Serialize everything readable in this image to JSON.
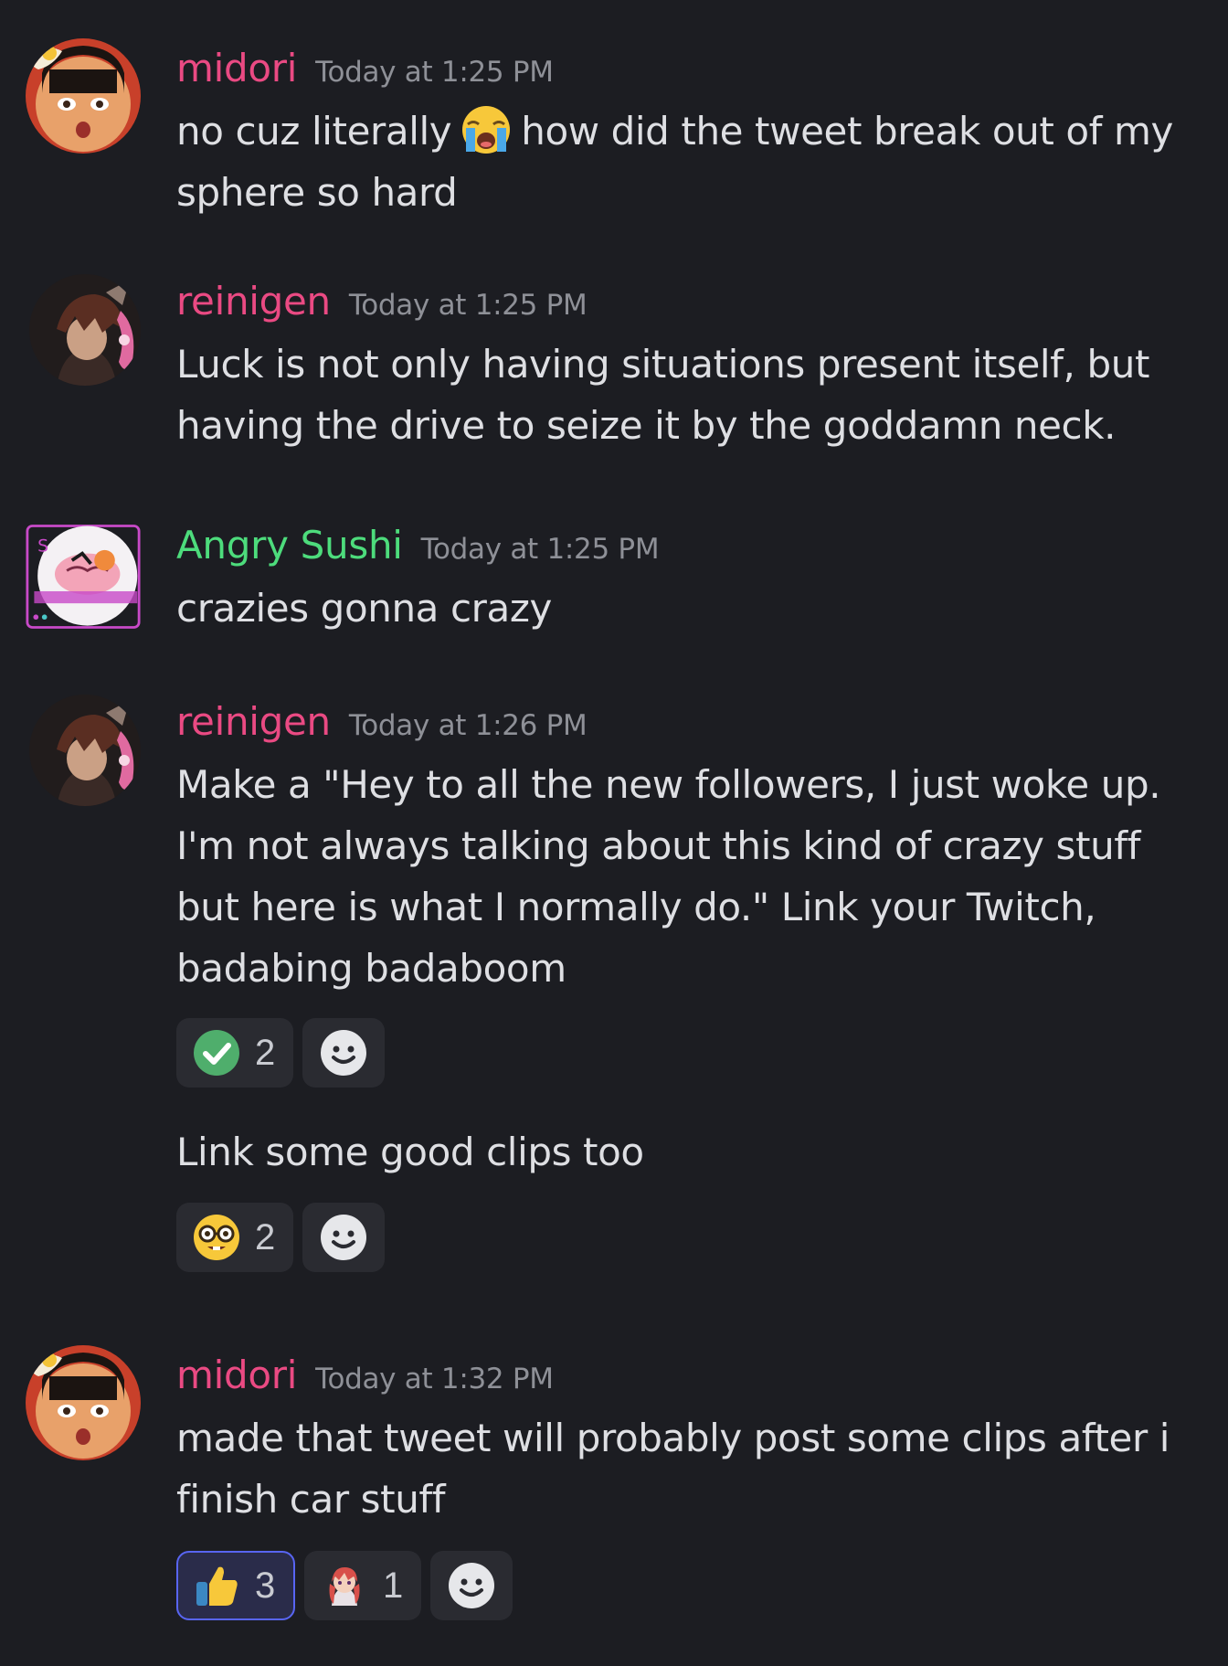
{
  "messages": [
    {
      "username": "midori",
      "timestamp": "Today at 1:25 PM",
      "text_before": "no cuz literally",
      "inline_emoji": "loudly-crying-face-icon",
      "text_after": "how did the tweet break out of my sphere so hard"
    },
    {
      "username": "reinigen",
      "timestamp": "Today at 1:25 PM",
      "text": "Luck is not only having situations present itself, but having the drive to seize it by the goddamn neck."
    },
    {
      "username": "Angry Sushi",
      "timestamp": "Today at 1:25 PM",
      "text": "crazies gonna crazy"
    },
    {
      "username": "reinigen",
      "timestamp": "Today at 1:26 PM",
      "text": "Make a \"Hey to all the new followers, I just woke up. I'm not always talking about this kind of crazy stuff but here is what I normally do.\" Link your Twitch, badabing badaboom",
      "reactions": [
        {
          "emoji": "green-check-icon",
          "count": "2"
        }
      ],
      "followup_text": "Link some good clips too",
      "followup_reactions": [
        {
          "emoji": "nerd-face-icon",
          "count": "2"
        }
      ]
    },
    {
      "username": "midori",
      "timestamp": "Today at 1:32 PM",
      "text": "made that tweet will probably post some clips after i finish car stuff",
      "reactions": [
        {
          "emoji": "thumbs-up-icon",
          "count": "3",
          "active": true
        },
        {
          "emoji": "anime-girl-custom-emoji",
          "count": "1"
        }
      ]
    }
  ],
  "colors": {
    "background": "#1c1d22",
    "username_pink": "#ea4a83",
    "username_green": "#4ddc7c",
    "timestamp": "#8e9097",
    "reaction_bg": "#2a2b31",
    "reaction_active_border": "#5865f2"
  },
  "icons": {
    "add_reaction": "smiley-add-reaction-icon"
  }
}
